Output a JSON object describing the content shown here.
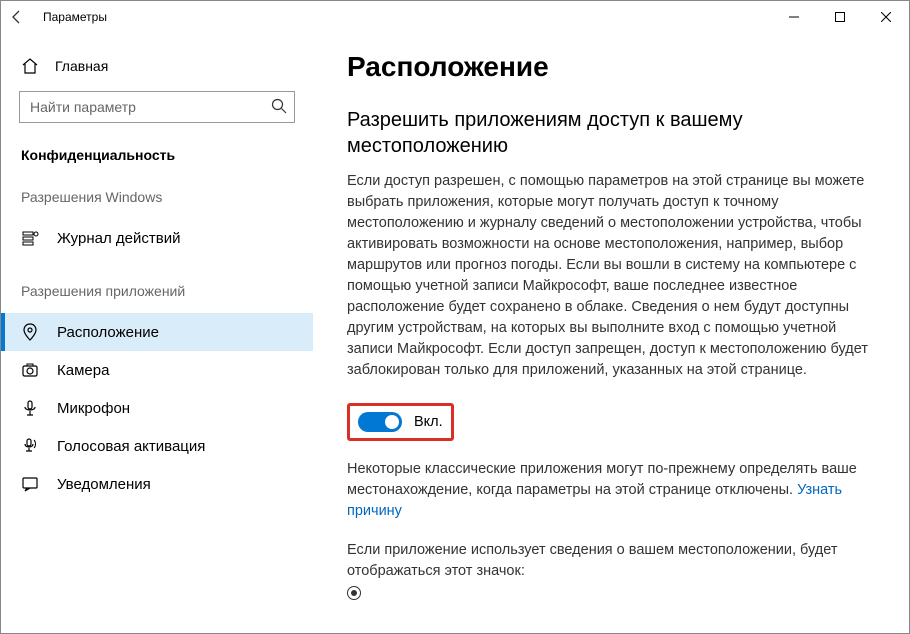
{
  "window": {
    "title": "Параметры"
  },
  "sidebar": {
    "home": "Главная",
    "search_placeholder": "Найти параметр",
    "category": "Конфиденциальность",
    "section_windows": "Разрешения Windows",
    "section_apps": "Разрешения приложений",
    "items_windows": [
      {
        "label": "Журнал действий"
      }
    ],
    "items_apps": [
      {
        "label": "Расположение",
        "active": true
      },
      {
        "label": "Камера"
      },
      {
        "label": "Микрофон"
      },
      {
        "label": "Голосовая активация"
      },
      {
        "label": "Уведомления"
      }
    ]
  },
  "main": {
    "title": "Расположение",
    "subtitle": "Разрешить приложениям доступ к вашему местоположению",
    "body1": "Если доступ разрешен, с помощью параметров на этой странице вы можете выбрать приложения, которые могут получать доступ к точному местоположению и журналу сведений о местоположении устройства, чтобы активировать возможности на основе местоположения, например, выбор маршрутов или прогноз погоды. Если вы вошли в систему на компьютере с помощью учетной записи Майкрософт, ваше последнее известное расположение будет сохранено в облаке. Сведения о нем будут доступны другим устройствам, на которых вы выполните вход с помощью учетной записи Майкрософт. Если доступ запрещен, доступ к местоположению будет заблокирован только для приложений, указанных на этой странице.",
    "toggle_state": true,
    "toggle_label": "Вкл.",
    "body2_a": "Некоторые классические приложения могут по-прежнему определять ваше местонахождение, когда параметры на этой странице отключены. ",
    "body2_link": "Узнать причину",
    "body3": "Если приложение использует сведения о вашем местоположении, будет отображаться этот значок:"
  }
}
